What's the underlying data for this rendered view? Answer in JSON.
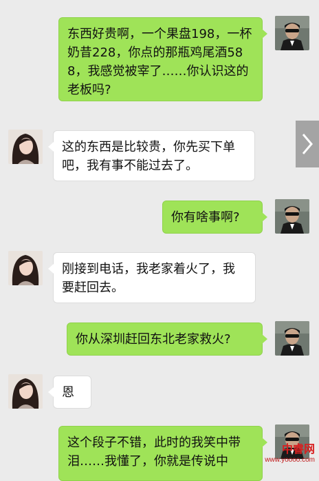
{
  "chat": {
    "messages": [
      {
        "side": "right",
        "text": "东西好贵啊，一个果盘198，一杯奶昔228，你点的那瓶鸡尾酒588，我感觉被宰了……你认识这的老板吗?"
      },
      {
        "side": "left",
        "text": "这的东西是比较贵，你先买下单吧，我有事不能过去了。"
      },
      {
        "side": "right",
        "text": "你有啥事啊?"
      },
      {
        "side": "left",
        "text": "刚接到电话，我老家着火了，我要赶回去。"
      },
      {
        "side": "right",
        "text": "你从深圳赶回东北老家救火?"
      },
      {
        "side": "left",
        "text": "恩"
      },
      {
        "side": "right",
        "text": "这个段子不错，此时的我笑中带泪……我懂了，你就是传说中"
      }
    ]
  },
  "icons": {
    "next_arrow": "chevron-right-icon"
  },
  "watermark": {
    "main": "中睿网",
    "url": "www.yoooo.com"
  },
  "colors": {
    "sent_bubble": "#9fe358",
    "received_bubble": "#ffffff",
    "background": "#ebebeb",
    "watermark": "#d72020"
  }
}
